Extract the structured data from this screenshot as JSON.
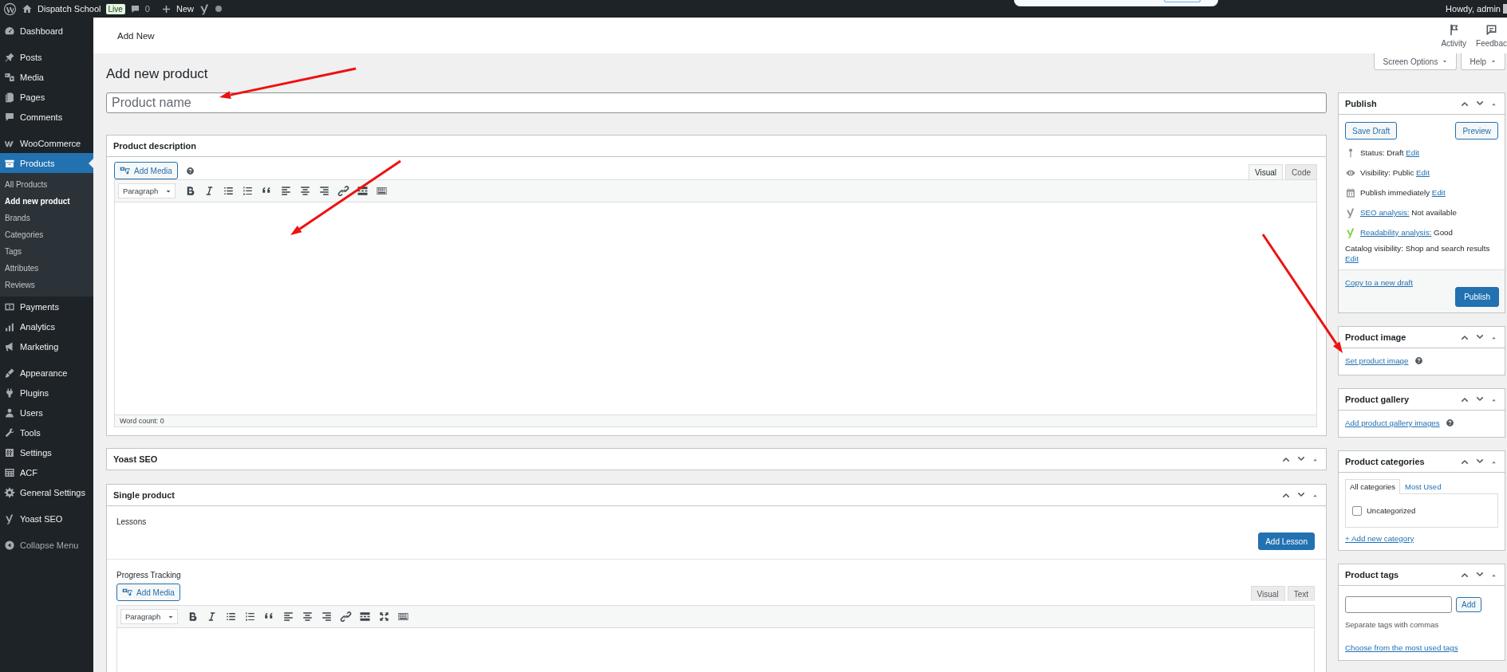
{
  "admin_bar": {
    "site_name": "Dispatch School",
    "badge": "Live",
    "comments_count": "0",
    "new_label": "New",
    "greeting": "Howdy, admin"
  },
  "header": {
    "title": "Add New",
    "actions": [
      {
        "label": "Activity"
      },
      {
        "label": "Feedbac"
      }
    ]
  },
  "sidebar": {
    "groups": [
      {
        "items": [
          {
            "label": "Dashboard",
            "selected": false
          }
        ]
      },
      {
        "items": [
          {
            "label": "Posts",
            "selected": false
          },
          {
            "label": "Media",
            "selected": false
          },
          {
            "label": "Pages",
            "selected": false
          },
          {
            "label": "Comments",
            "selected": false
          }
        ]
      },
      {
        "items": [
          {
            "label": "WooCommerce",
            "selected": false
          },
          {
            "label": "Products",
            "selected": true,
            "children": [
              {
                "label": "All Products",
                "selected": false
              },
              {
                "label": "Add new product",
                "selected": true
              },
              {
                "label": "Brands",
                "selected": false
              },
              {
                "label": "Categories",
                "selected": false
              },
              {
                "label": "Tags",
                "selected": false
              },
              {
                "label": "Attributes",
                "selected": false
              },
              {
                "label": "Reviews",
                "selected": false
              }
            ]
          },
          {
            "label": "Payments",
            "selected": false
          },
          {
            "label": "Analytics",
            "selected": false
          },
          {
            "label": "Marketing",
            "selected": false
          }
        ]
      },
      {
        "items": [
          {
            "label": "Appearance",
            "selected": false
          },
          {
            "label": "Plugins",
            "selected": false
          },
          {
            "label": "Users",
            "selected": false
          },
          {
            "label": "Tools",
            "selected": false
          },
          {
            "label": "Settings",
            "selected": false
          },
          {
            "label": "ACF",
            "selected": false
          },
          {
            "label": "General Settings",
            "selected": false
          }
        ]
      },
      {
        "items": [
          {
            "label": "Yoast SEO",
            "selected": false
          }
        ]
      }
    ],
    "collapse_label": "Collapse Menu"
  },
  "screen_tabs": [
    {
      "label": "Screen Options"
    },
    {
      "label": "Help"
    }
  ],
  "page_title": "Add new product",
  "product_name": {
    "placeholder": "Product name"
  },
  "description_box": {
    "title": "Product description",
    "add_media": "Add Media",
    "mode_tabs": [
      {
        "label": "Visual",
        "selected": true
      },
      {
        "label": "Code",
        "selected": false
      }
    ],
    "format": "Paragraph",
    "word_count": "Word count: 0"
  },
  "yoast_box": {
    "title": "Yoast SEO"
  },
  "single_product": {
    "title": "Single product",
    "lessons_label": "Lessons",
    "add_lesson": "Add Lesson",
    "progress_label": "Progress Tracking",
    "add_media": "Add Media",
    "mode_tabs": [
      {
        "label": "Visual",
        "selected": false
      },
      {
        "label": "Text",
        "selected": false
      }
    ],
    "format": "Paragraph"
  },
  "publish": {
    "title": "Publish",
    "save_draft": "Save Draft",
    "preview": "Preview",
    "rows": [
      {
        "kind": "text_link",
        "text": "Status: Draft",
        "link": "Edit"
      },
      {
        "kind": "text_link",
        "text": "Visibility: Public",
        "link": "Edit"
      },
      {
        "kind": "text_link",
        "text": "Publish immediately",
        "link": "Edit"
      },
      {
        "kind": "link_text",
        "link": "SEO analysis:",
        "text": "Not available",
        "color": "#8c8f94"
      },
      {
        "kind": "link_text",
        "link": "Readability analysis:",
        "text": "Good",
        "color": "#7ad03a"
      },
      {
        "kind": "text_break_link",
        "text": "Catalog visibility: Shop and search results",
        "link": "Edit"
      }
    ],
    "copy_link": "Copy to a new draft",
    "publish_button": "Publish"
  },
  "product_image": {
    "title": "Product image",
    "link": "Set product image"
  },
  "product_gallery": {
    "title": "Product gallery",
    "link": "Add product gallery images"
  },
  "product_categories": {
    "title": "Product categories",
    "tabs": [
      {
        "label": "All categories",
        "selected": true
      },
      {
        "label": "Most Used",
        "selected": false
      }
    ],
    "items": [
      {
        "label": "Uncategorized",
        "checked": false
      }
    ],
    "add_link": "+ Add new category"
  },
  "product_tags": {
    "title": "Product tags",
    "add_button": "Add",
    "hint": "Separate tags with commas",
    "link": "Choose from the most used tags"
  }
}
